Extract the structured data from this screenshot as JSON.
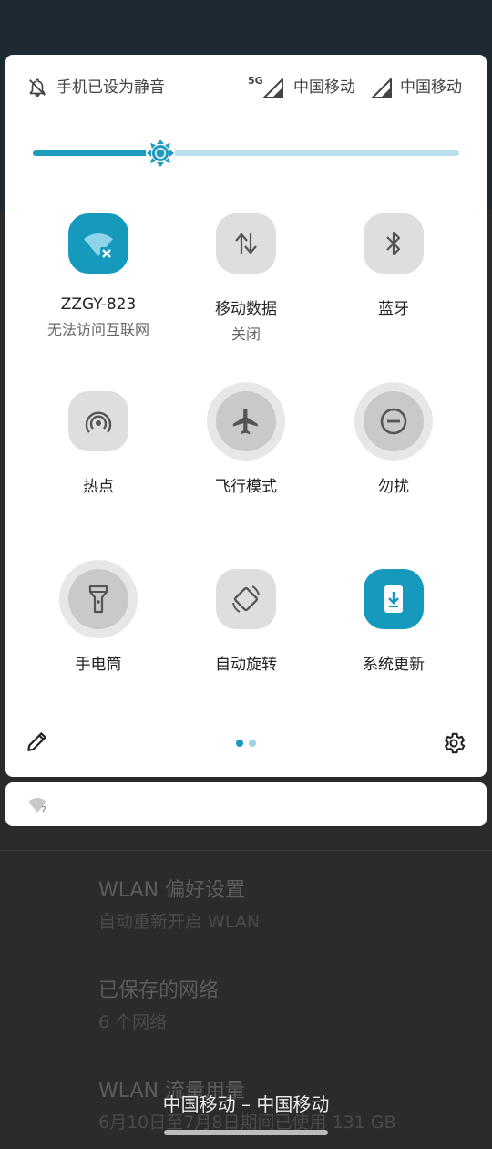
{
  "status": {
    "silent_text": "手机已设为静音",
    "network_type": "5G",
    "carrier_1": "中国移动",
    "carrier_2": "中国移动"
  },
  "brightness": {
    "level": 0.3
  },
  "tiles": [
    {
      "label": "ZZGY-823",
      "sub": "无法访问互联网",
      "icon": "wifi-x-icon",
      "state": "on"
    },
    {
      "label": "移动数据",
      "sub": "关闭",
      "icon": "mobile-data-icon",
      "state": "off"
    },
    {
      "label": "蓝牙",
      "sub": "",
      "icon": "bluetooth-icon",
      "state": "off"
    },
    {
      "label": "热点",
      "icon": "hotspot-icon",
      "state": "off"
    },
    {
      "label": "飞行模式",
      "icon": "airplane-icon",
      "state": "ring"
    },
    {
      "label": "勿扰",
      "icon": "dnd-icon",
      "state": "ring"
    },
    {
      "label": "手电筒",
      "icon": "flashlight-icon",
      "state": "ring"
    },
    {
      "label": "自动旋转",
      "icon": "auto-rotate-icon",
      "state": "off"
    },
    {
      "label": "系统更新",
      "icon": "system-update-icon",
      "state": "on"
    }
  ],
  "pager": {
    "pages": 2,
    "current": 1
  },
  "colors": {
    "accent": "#1599bd",
    "tile_off": "#dedede",
    "track": "#b9e0ea"
  },
  "background_page": {
    "items": [
      {
        "title": "WLAN 偏好设置",
        "sub": "自动重新开启 WLAN"
      },
      {
        "title": "已保存的网络",
        "sub": "6 个网络"
      },
      {
        "title": "WLAN 流量用量",
        "sub": "6月10日至7月8日期间已使用 131 GB"
      }
    ]
  },
  "bottom_carrier": "中国移动 – 中国移动"
}
